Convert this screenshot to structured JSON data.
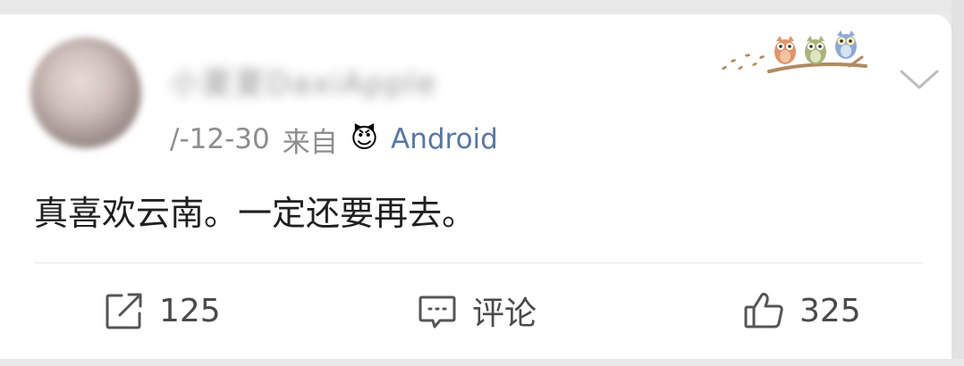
{
  "post": {
    "author": {
      "nickname": "小夏夏DaxiApple"
    },
    "date": "/-12-30",
    "source_label": "来自",
    "source_emoji": "😈",
    "source_device": "Android",
    "text": "真喜欢云南。一定还要再去。"
  },
  "actions": {
    "repost_count": "125",
    "comment_label": "评论",
    "like_count": "325"
  },
  "icons": {
    "repost": "share-box-icon",
    "comment": "comment-bubble-icon",
    "like": "thumbs-up-icon",
    "menu": "chevron-down-icon",
    "decoration": "owls-on-branch"
  },
  "colors": {
    "source_device": "#5677a6",
    "meta_text": "#8d8d8d",
    "body_text": "#202020"
  }
}
